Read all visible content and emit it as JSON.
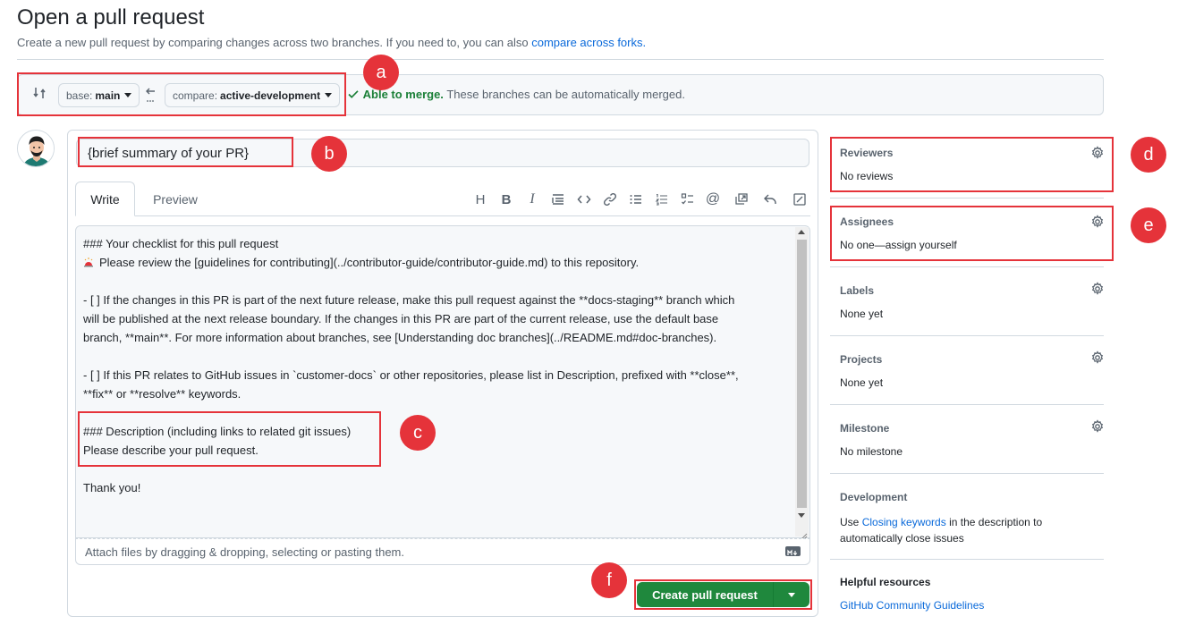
{
  "header": {
    "title": "Open a pull request",
    "subtitle": "Create a new pull request by comparing changes across two branches. If you need to, you can also",
    "subtitle_link": "compare across forks."
  },
  "compare": {
    "base_label": "base:",
    "base_value": "main",
    "compare_label": "compare:",
    "compare_value": "active-development",
    "status_ok": "Able to merge.",
    "status_text": "These branches can be automatically merged."
  },
  "composer": {
    "title_value": "{brief summary of your PR}",
    "tabs": {
      "write": "Write",
      "preview": "Preview"
    },
    "toolbar_icons": [
      "heading-icon",
      "bold-icon",
      "italic-icon",
      "quote-icon",
      "code-icon",
      "link-icon",
      "unordered-list-icon",
      "ordered-list-icon",
      "task-list-icon",
      "mention-icon",
      "reference-icon",
      "reply-icon",
      "fullscreen-icon"
    ],
    "toolbar_glyphs": {
      "heading": "H",
      "bold": "B",
      "italic": "I",
      "mention": "@"
    },
    "body_lines": [
      "### Your checklist for this pull request",
      "Please review the [guidelines for contributing](../contributor-guide/contributor-guide.md) to this repository.",
      "",
      "- [ ] If the changes in this PR is part of the next future release, make this pull request against the **docs-staging** branch which",
      "will be published at the next release boundary. If the changes in this PR are part of the current release, use the default base",
      "branch, **main**. For more information about branches, see [Understanding doc branches](../README.md#doc-branches).",
      "",
      "- [ ] If this PR relates to GitHub issues in `customer-docs` or other repositories, please list in Description, prefixed with **close**,",
      "**fix** or **resolve** keywords.",
      "",
      "### Description (including links to related git issues)",
      "Please describe your pull request.",
      "",
      "Thank you!"
    ],
    "attach_text": "Attach files by dragging & dropping, selecting or pasting them.",
    "submit_label": "Create pull request"
  },
  "sidebar": {
    "reviewers": {
      "title": "Reviewers",
      "value": "No reviews"
    },
    "assignees": {
      "title": "Assignees",
      "value": "No one—assign yourself"
    },
    "labels": {
      "title": "Labels",
      "value": "None yet"
    },
    "projects": {
      "title": "Projects",
      "value": "None yet"
    },
    "milestone": {
      "title": "Milestone",
      "value": "No milestone"
    },
    "development": {
      "title": "Development",
      "pre": "Use",
      "link": "Closing keywords",
      "post": "in the description to",
      "line2": "automatically close issues"
    },
    "helpful": {
      "title": "Helpful resources",
      "link": "GitHub Community Guidelines"
    }
  },
  "annotations": [
    "a",
    "b",
    "c",
    "d",
    "e",
    "f"
  ],
  "colors": {
    "annotation": "#e5333a",
    "primary_button": "#1f883d",
    "success": "#1a7f37",
    "link": "#0969da"
  }
}
